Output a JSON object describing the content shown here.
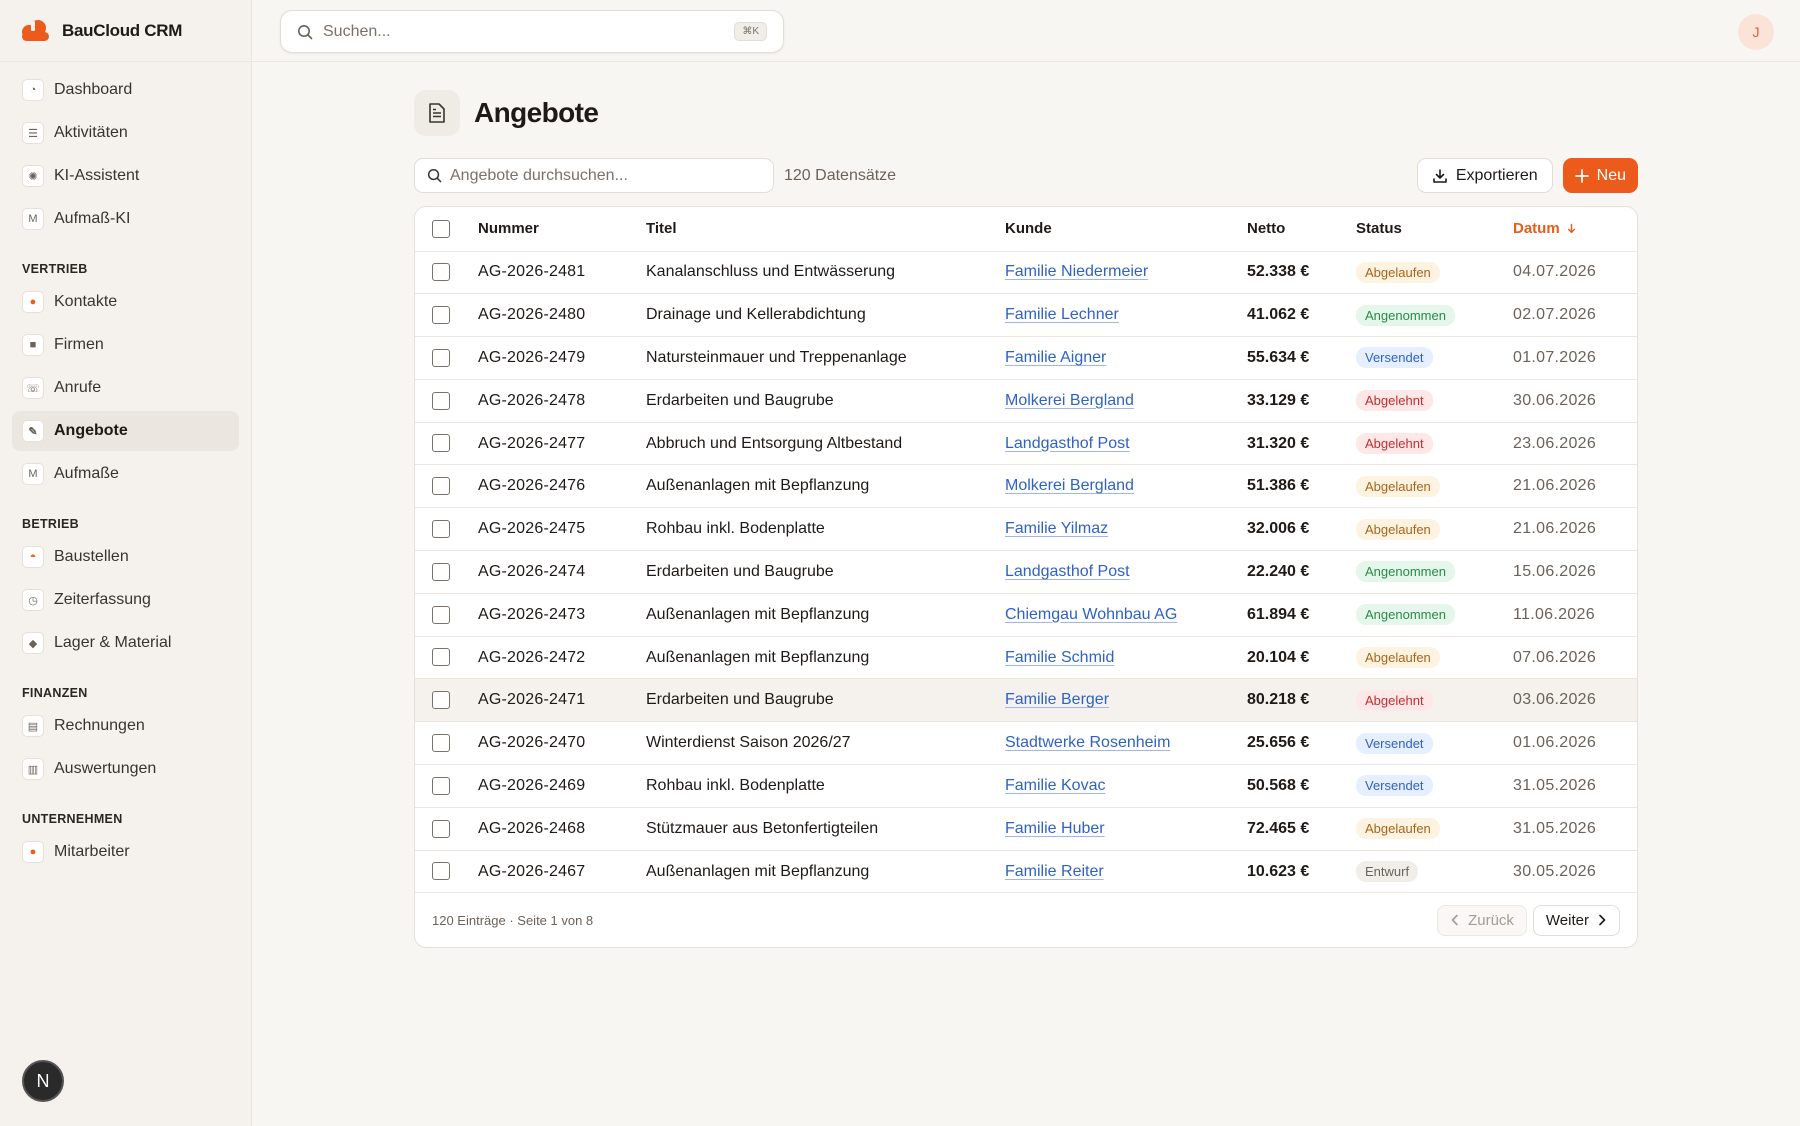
{
  "app": {
    "name": "BauCloud CRM"
  },
  "search": {
    "placeholder": "Suchen...",
    "shortcut": "⌘K"
  },
  "user": {
    "initial": "J"
  },
  "sidebar": {
    "top": [
      {
        "label": "Dashboard",
        "icon": "gauge-icon"
      },
      {
        "label": "Aktivitäten",
        "icon": "activity-list-icon"
      },
      {
        "label": "KI-Assistent",
        "icon": "sparkle-icon"
      },
      {
        "label": "Aufmaß-KI",
        "icon": "measure-icon"
      }
    ],
    "sections": [
      {
        "title": "VERTRIEB",
        "items": [
          {
            "label": "Kontakte",
            "icon": "contacts-icon"
          },
          {
            "label": "Firmen",
            "icon": "company-icon"
          },
          {
            "label": "Anrufe",
            "icon": "phone-icon"
          },
          {
            "label": "Angebote",
            "icon": "offer-icon",
            "active": true
          },
          {
            "label": "Aufmaße",
            "icon": "measure-icon"
          }
        ]
      },
      {
        "title": "BETRIEB",
        "items": [
          {
            "label": "Baustellen",
            "icon": "helmet-icon"
          },
          {
            "label": "Zeiterfassung",
            "icon": "clock-icon"
          },
          {
            "label": "Lager & Material",
            "icon": "box-icon"
          }
        ]
      },
      {
        "title": "FINANZEN",
        "items": [
          {
            "label": "Rechnungen",
            "icon": "invoice-icon"
          },
          {
            "label": "Auswertungen",
            "icon": "chart-icon"
          }
        ]
      },
      {
        "title": "UNTERNEHMEN",
        "items": [
          {
            "label": "Mitarbeiter",
            "icon": "person-icon"
          }
        ]
      }
    ],
    "bottom_badge": "N"
  },
  "page": {
    "title": "Angebote",
    "table_search_placeholder": "Angebote durchsuchen...",
    "record_count": "120 Datensätze",
    "export_label": "Exportieren",
    "new_label": "Neu"
  },
  "table": {
    "columns": {
      "number": "Nummer",
      "title": "Titel",
      "customer": "Kunde",
      "net": "Netto",
      "status": "Status",
      "date": "Datum"
    },
    "rows": [
      {
        "number": "AG-2026-2481",
        "title": "Kanalanschluss und Entwässerung",
        "customer": "Familie Niedermeier",
        "net": "52.338 €",
        "status": "Abgelaufen",
        "date": "04.07.2026"
      },
      {
        "number": "AG-2026-2480",
        "title": "Drainage und Kellerabdichtung",
        "customer": "Familie Lechner",
        "net": "41.062 €",
        "status": "Angenommen",
        "date": "02.07.2026"
      },
      {
        "number": "AG-2026-2479",
        "title": "Natursteinmauer und Treppenanlage",
        "customer": "Familie Aigner",
        "net": "55.634 €",
        "status": "Versendet",
        "date": "01.07.2026"
      },
      {
        "number": "AG-2026-2478",
        "title": "Erdarbeiten und Baugrube",
        "customer": "Molkerei Bergland",
        "net": "33.129 €",
        "status": "Abgelehnt",
        "date": "30.06.2026"
      },
      {
        "number": "AG-2026-2477",
        "title": "Abbruch und Entsorgung Altbestand",
        "customer": "Landgasthof Post",
        "net": "31.320 €",
        "status": "Abgelehnt",
        "date": "23.06.2026"
      },
      {
        "number": "AG-2026-2476",
        "title": "Außenanlagen mit Bepflanzung",
        "customer": "Molkerei Bergland",
        "net": "51.386 €",
        "status": "Abgelaufen",
        "date": "21.06.2026"
      },
      {
        "number": "AG-2026-2475",
        "title": "Rohbau inkl. Bodenplatte",
        "customer": "Familie Yilmaz",
        "net": "32.006 €",
        "status": "Abgelaufen",
        "date": "21.06.2026"
      },
      {
        "number": "AG-2026-2474",
        "title": "Erdarbeiten und Baugrube",
        "customer": "Landgasthof Post",
        "net": "22.240 €",
        "status": "Angenommen",
        "date": "15.06.2026"
      },
      {
        "number": "AG-2026-2473",
        "title": "Außenanlagen mit Bepflanzung",
        "customer": "Chiemgau Wohnbau AG",
        "net": "61.894 €",
        "status": "Angenommen",
        "date": "11.06.2026"
      },
      {
        "number": "AG-2026-2472",
        "title": "Außenanlagen mit Bepflanzung",
        "customer": "Familie Schmid",
        "net": "20.104 €",
        "status": "Abgelaufen",
        "date": "07.06.2026"
      },
      {
        "number": "AG-2026-2471",
        "title": "Erdarbeiten und Baugrube",
        "customer": "Familie Berger",
        "net": "80.218 €",
        "status": "Abgelehnt",
        "date": "03.06.2026",
        "hovered": true
      },
      {
        "number": "AG-2026-2470",
        "title": "Winterdienst Saison 2026/27",
        "customer": "Stadtwerke Rosenheim",
        "net": "25.656 €",
        "status": "Versendet",
        "date": "01.06.2026"
      },
      {
        "number": "AG-2026-2469",
        "title": "Rohbau inkl. Bodenplatte",
        "customer": "Familie Kovac",
        "net": "50.568 €",
        "status": "Versendet",
        "date": "31.05.2026"
      },
      {
        "number": "AG-2026-2468",
        "title": "Stützmauer aus Betonfertigteilen",
        "customer": "Familie Huber",
        "net": "72.465 €",
        "status": "Abgelaufen",
        "date": "31.05.2026"
      },
      {
        "number": "AG-2026-2467",
        "title": "Außenanlagen mit Bepflanzung",
        "customer": "Familie Reiter",
        "net": "10.623 €",
        "status": "Entwurf",
        "date": "30.05.2026"
      }
    ],
    "footer_info": "120 Einträge · Seite 1 von 8",
    "prev_label": "Zurück",
    "next_label": "Weiter"
  },
  "colors": {
    "accent": "#ec5a1c",
    "link": "#2f62c4"
  }
}
